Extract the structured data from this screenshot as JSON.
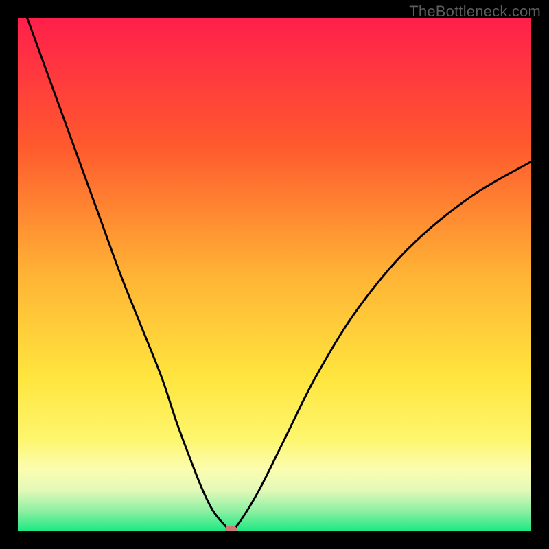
{
  "watermark": "TheBottleneck.com",
  "chart_data": {
    "type": "line",
    "title": "",
    "xlabel": "",
    "ylabel": "",
    "xlim": [
      0,
      100
    ],
    "ylim": [
      0,
      100
    ],
    "gradient_stops": [
      {
        "offset": 0,
        "color": "#ff1f4b"
      },
      {
        "offset": 25,
        "color": "#ff5a2e"
      },
      {
        "offset": 50,
        "color": "#ffb335"
      },
      {
        "offset": 70,
        "color": "#ffe53e"
      },
      {
        "offset": 82,
        "color": "#fdf66d"
      },
      {
        "offset": 88,
        "color": "#fbfdb0"
      },
      {
        "offset": 92,
        "color": "#e3f9b8"
      },
      {
        "offset": 96,
        "color": "#8ff0a3"
      },
      {
        "offset": 100,
        "color": "#1de883"
      }
    ],
    "series": [
      {
        "name": "bottleneck-curve",
        "x": [
          0,
          4,
          8,
          12,
          16,
          20,
          24,
          28,
          31,
          34,
          36,
          38,
          40,
          41.5,
          43,
          47,
          52,
          58,
          66,
          76,
          88,
          100
        ],
        "y": [
          105,
          94,
          83,
          72,
          61,
          50,
          40,
          30,
          21,
          13,
          8,
          4,
          1.5,
          0.3,
          1.5,
          8,
          18,
          30,
          43,
          55,
          65,
          72
        ]
      }
    ],
    "markers": [
      {
        "name": "optimal-point",
        "x": 41.5,
        "y": 0.3,
        "color": "#cd7a74"
      }
    ]
  }
}
